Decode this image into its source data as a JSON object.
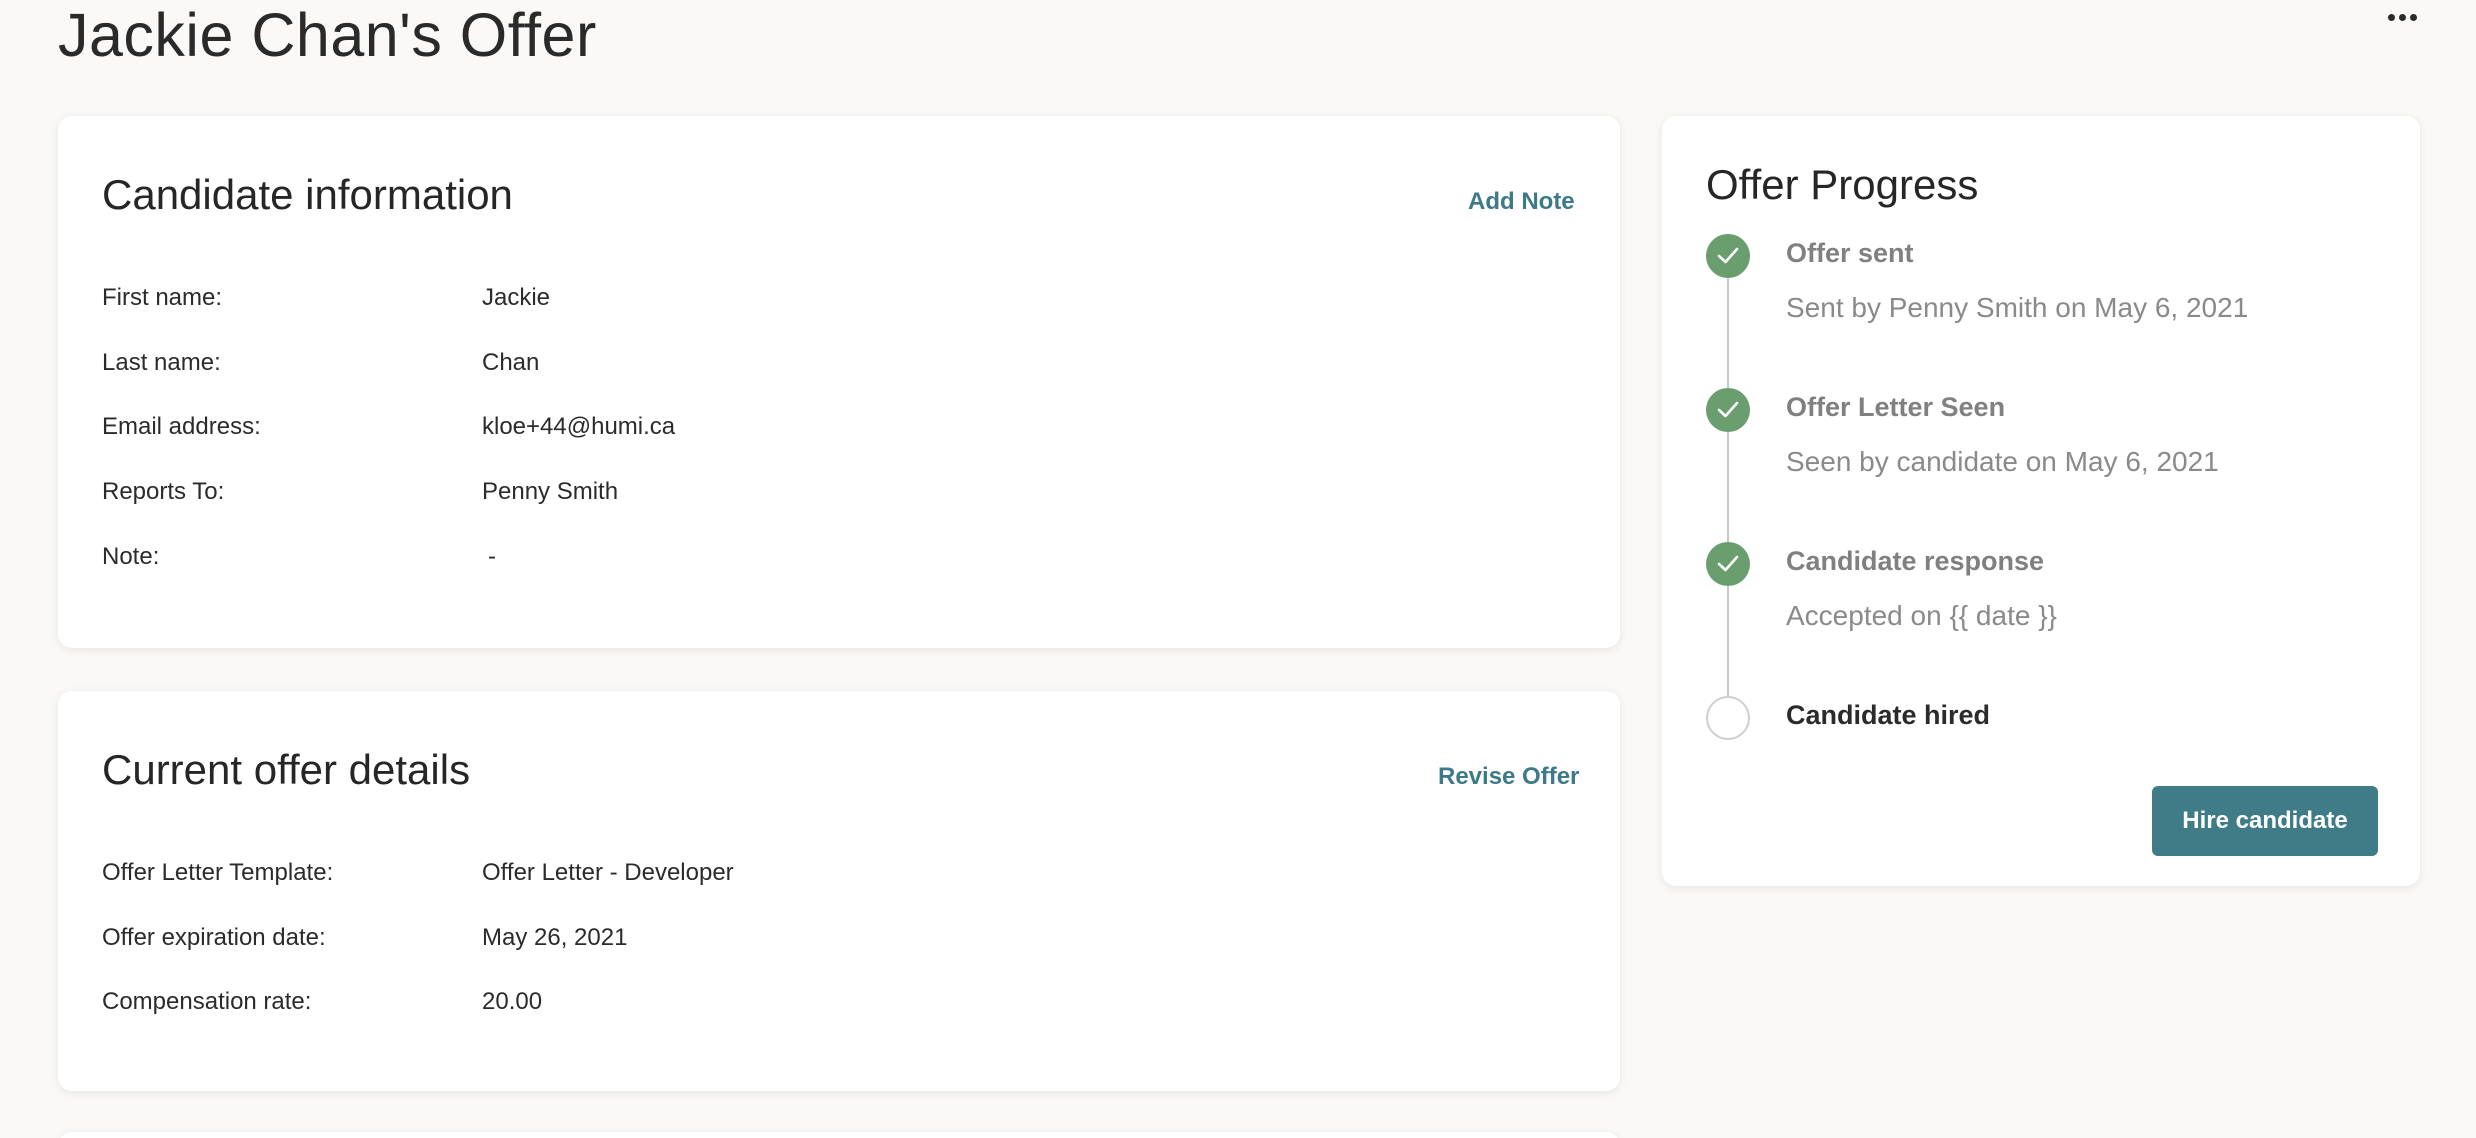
{
  "page": {
    "title": "Jackie Chan's Offer"
  },
  "candidate_card": {
    "title": "Candidate information",
    "action_label": "Add Note",
    "fields": [
      {
        "label": "First name:",
        "value": "Jackie"
      },
      {
        "label": "Last name:",
        "value": "Chan"
      },
      {
        "label": "Email address:",
        "value": "kloe+44@humi.ca"
      },
      {
        "label": "Reports To:",
        "value": "Penny Smith"
      },
      {
        "label": "Note:",
        "value": "-"
      }
    ]
  },
  "offer_card": {
    "title": "Current offer details",
    "action_label": "Revise Offer",
    "fields": [
      {
        "label": "Offer Letter Template:",
        "value": "Offer Letter - Developer"
      },
      {
        "label": "Offer expiration date:",
        "value": "May 26, 2021"
      },
      {
        "label": "Compensation rate:",
        "value": "20.00"
      }
    ]
  },
  "progress_card": {
    "title": "Offer Progress",
    "steps": [
      {
        "title": "Offer sent",
        "description": "Sent by Penny Smith on May 6, 2021",
        "status": "complete"
      },
      {
        "title": "Offer Letter Seen",
        "description": "Seen by candidate on May 6, 2021",
        "status": "complete"
      },
      {
        "title": "Candidate response",
        "description": "Accepted on {{ date }}",
        "status": "complete"
      },
      {
        "title": "Candidate hired",
        "description": "",
        "status": "pending"
      }
    ],
    "button_label": "Hire candidate"
  },
  "icons": {
    "more_menu": "more-horizontal-icon",
    "step_complete": "check-icon"
  },
  "colors": {
    "accent": "#3d7a88",
    "button": "#3f7c87",
    "step_complete": "#6b9e6f",
    "background": "#faf9f7"
  }
}
